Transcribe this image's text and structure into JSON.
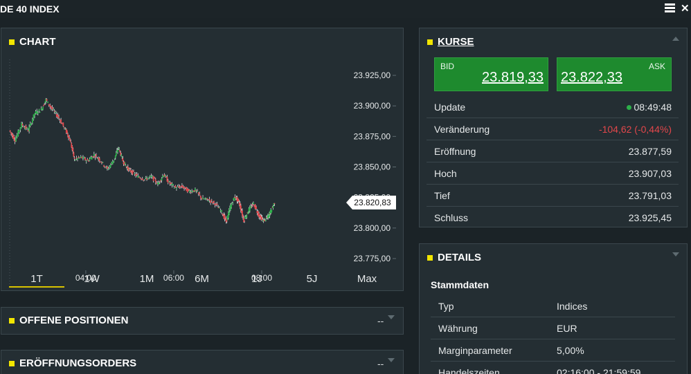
{
  "window": {
    "title": "DE 40 INDEX",
    "menu_icon": "hamburger-menu-icon",
    "close_icon": "close-icon"
  },
  "chart_panel": {
    "title": "CHART",
    "accent": "#f2e600",
    "ranges": [
      "1T",
      "1W",
      "1M",
      "6M",
      "1J",
      "5J",
      "Max"
    ],
    "active_range": "1T"
  },
  "chart_data": {
    "type": "candlestick",
    "title": "",
    "xlabel": "",
    "ylabel": "",
    "x_ticks": [
      "04:00",
      "06:00",
      "08:00"
    ],
    "y_ticks": [
      "23.925,00",
      "23.900,00",
      "23.875,00",
      "23.850,00",
      "23.825,00",
      "23.800,00",
      "23.775,00"
    ],
    "ylim": [
      23775,
      23925
    ],
    "xlim_hours": [
      2.27,
      8.85
    ],
    "current_price_label": "23.820,83",
    "current_price": 23820.83,
    "up_color": "#2db04a",
    "down_color": "#e2474b",
    "series": [
      {
        "points": [
          [
            2.27,
            23880
          ],
          [
            2.4,
            23872
          ],
          [
            2.55,
            23885
          ],
          [
            2.7,
            23880
          ],
          [
            2.85,
            23894
          ],
          [
            3.0,
            23897
          ],
          [
            3.1,
            23905
          ],
          [
            3.25,
            23897
          ],
          [
            3.4,
            23890
          ],
          [
            3.55,
            23880
          ],
          [
            3.65,
            23872
          ],
          [
            3.75,
            23856
          ],
          [
            3.9,
            23858
          ],
          [
            4.05,
            23855
          ],
          [
            4.2,
            23860
          ],
          [
            4.35,
            23855
          ],
          [
            4.5,
            23848
          ],
          [
            4.65,
            23856
          ],
          [
            4.75,
            23866
          ],
          [
            4.85,
            23855
          ],
          [
            4.95,
            23849
          ],
          [
            5.05,
            23846
          ],
          [
            5.2,
            23842
          ],
          [
            5.35,
            23840
          ],
          [
            5.5,
            23842
          ],
          [
            5.65,
            23836
          ],
          [
            5.78,
            23844
          ],
          [
            5.9,
            23837
          ],
          [
            6.05,
            23833
          ],
          [
            6.2,
            23834
          ],
          [
            6.35,
            23830
          ],
          [
            6.5,
            23831
          ],
          [
            6.65,
            23824
          ],
          [
            6.8,
            23823
          ],
          [
            6.95,
            23820
          ],
          [
            7.1,
            23813
          ],
          [
            7.2,
            23805
          ],
          [
            7.3,
            23818
          ],
          [
            7.4,
            23826
          ],
          [
            7.5,
            23820
          ],
          [
            7.6,
            23806
          ],
          [
            7.7,
            23814
          ],
          [
            7.82,
            23820
          ],
          [
            7.95,
            23810
          ],
          [
            8.05,
            23806
          ],
          [
            8.15,
            23809
          ],
          [
            8.2,
            23813
          ],
          [
            8.3,
            23821
          ]
        ]
      }
    ]
  },
  "positions_panel": {
    "title": "OFFENE POSITIONEN",
    "value": "--"
  },
  "orders_panel": {
    "title": "ERÖFFNUNGSORDERS",
    "value": "--"
  },
  "quotes_panel": {
    "title": "KURSE",
    "bid": {
      "label": "BID",
      "value": "23.819,33"
    },
    "ask": {
      "label": "ASK",
      "value": "23.822,33"
    },
    "rows": [
      {
        "label": "Update",
        "value": "08:49:48"
      },
      {
        "label": "Veränderung",
        "value": "-104,62 (-0,44%)"
      },
      {
        "label": "Eröffnung",
        "value": "23.877,59"
      },
      {
        "label": "Hoch",
        "value": "23.907,03"
      },
      {
        "label": "Tief",
        "value": "23.791,03"
      },
      {
        "label": "Schluss",
        "value": "23.925,45"
      }
    ]
  },
  "details_panel": {
    "title": "DETAILS",
    "section": "Stammdaten",
    "rows": [
      {
        "label": "Typ",
        "value": "Indices"
      },
      {
        "label": "Währung",
        "value": "EUR"
      },
      {
        "label": "Marginparameter",
        "value": "5,00%"
      },
      {
        "label": "Handelszeiten",
        "value": "02:16:00 - 21:59:59"
      }
    ]
  }
}
